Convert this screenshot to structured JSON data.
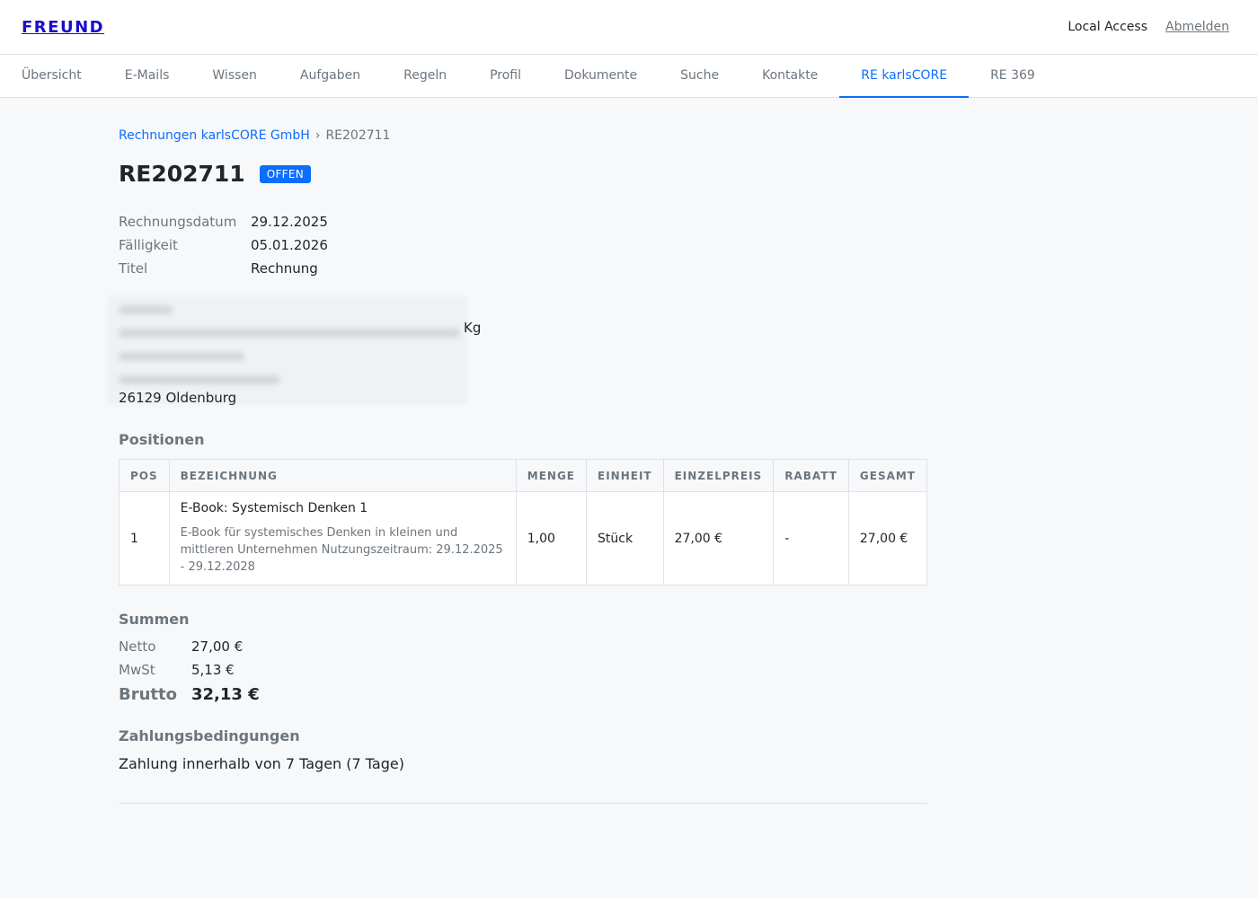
{
  "header": {
    "brand": "FREUND",
    "local_access": "Local Access",
    "logout": "Abmelden"
  },
  "tabs": [
    {
      "label": "Übersicht"
    },
    {
      "label": "E-Mails"
    },
    {
      "label": "Wissen"
    },
    {
      "label": "Aufgaben"
    },
    {
      "label": "Regeln"
    },
    {
      "label": "Profil"
    },
    {
      "label": "Dokumente"
    },
    {
      "label": "Suche"
    },
    {
      "label": "Kontakte"
    },
    {
      "label": "RE karlsCORE",
      "active": true
    },
    {
      "label": "RE 369"
    }
  ],
  "breadcrumb": {
    "parent": "Rechnungen karlsCORE GmbH",
    "separator": "›",
    "current": "RE202711"
  },
  "invoice": {
    "number": "RE202711",
    "status": "OFFEN",
    "meta": [
      {
        "key": "Rechnungsdatum",
        "value": "29.12.2025"
      },
      {
        "key": "Fälligkeit",
        "value": "05.01.2026"
      },
      {
        "key": "Titel",
        "value": "Rechnung"
      }
    ],
    "address_tail": "Kg",
    "address_city": "26129 Oldenburg"
  },
  "positions": {
    "title": "Positionen",
    "columns": [
      "POS",
      "BEZEICHNUNG",
      "MENGE",
      "EINHEIT",
      "EINZELPREIS",
      "RABATT",
      "GESAMT"
    ],
    "rows": [
      {
        "pos": "1",
        "name": "E-Book: Systemisch Denken 1",
        "desc": "E-Book für systemisches Denken in kleinen und mittleren Unternehmen Nutzungszeitraum: 29.12.2025 - 29.12.2028",
        "qty": "1,00",
        "unit": "Stück",
        "price": "27,00 €",
        "discount": "-",
        "total": "27,00 €"
      }
    ]
  },
  "sums": {
    "title": "Summen",
    "netto_label": "Netto",
    "netto": "27,00 €",
    "mwst_label": "MwSt",
    "mwst": "5,13 €",
    "brutto_label": "Brutto",
    "brutto": "32,13 €"
  },
  "terms": {
    "title": "Zahlungsbedingungen",
    "text": "Zahlung innerhalb von 7 Tagen (7 Tage)"
  }
}
